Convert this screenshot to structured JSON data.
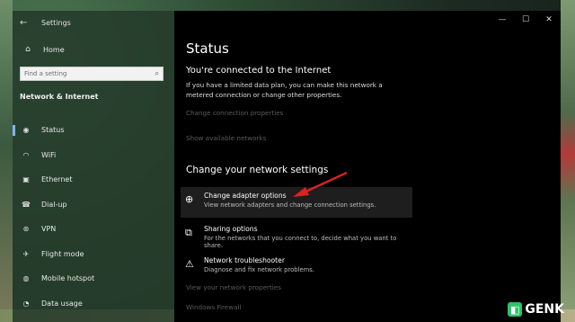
{
  "window": {
    "title": "Settings"
  },
  "controls": {
    "minimize": "—",
    "maximize": "☐",
    "close": "✕"
  },
  "sidebar": {
    "home_label": "Home",
    "search_placeholder": "Find a setting",
    "section_title": "Network & Internet",
    "items": [
      {
        "label": "Status",
        "icon": "globe-icon"
      },
      {
        "label": "WiFi",
        "icon": "wifi-icon"
      },
      {
        "label": "Ethernet",
        "icon": "ethernet-icon"
      },
      {
        "label": "Dial-up",
        "icon": "dialup-icon"
      },
      {
        "label": "VPN",
        "icon": "vpn-icon"
      },
      {
        "label": "Flight mode",
        "icon": "airplane-icon"
      },
      {
        "label": "Mobile hotspot",
        "icon": "hotspot-icon"
      },
      {
        "label": "Data usage",
        "icon": "data-usage-icon"
      }
    ]
  },
  "main": {
    "page_title": "Status",
    "connected_heading": "You're connected to the Internet",
    "connected_desc": "If you have a limited data plan, you can make this network a metered connection or change other properties.",
    "link_change_connection": "Change connection properties",
    "link_show_networks": "Show available networks",
    "network_settings_heading": "Change your network settings",
    "options": [
      {
        "title": "Change adapter options",
        "desc": "View network adapters and change connection settings.",
        "icon": "adapter-icon"
      },
      {
        "title": "Sharing options",
        "desc": "For the networks that you connect to, decide what you want to share.",
        "icon": "sharing-icon"
      },
      {
        "title": "Network troubleshooter",
        "desc": "Diagnose and fix network problems.",
        "icon": "warning-icon"
      }
    ],
    "link_view_properties": "View your network properties",
    "link_firewall": "Windows Firewall"
  },
  "watermark": {
    "text": "GENK"
  },
  "colors": {
    "accent": "#7fb4ff",
    "annotation_arrow": "#e02020",
    "watermark_green": "#2ec36a"
  }
}
